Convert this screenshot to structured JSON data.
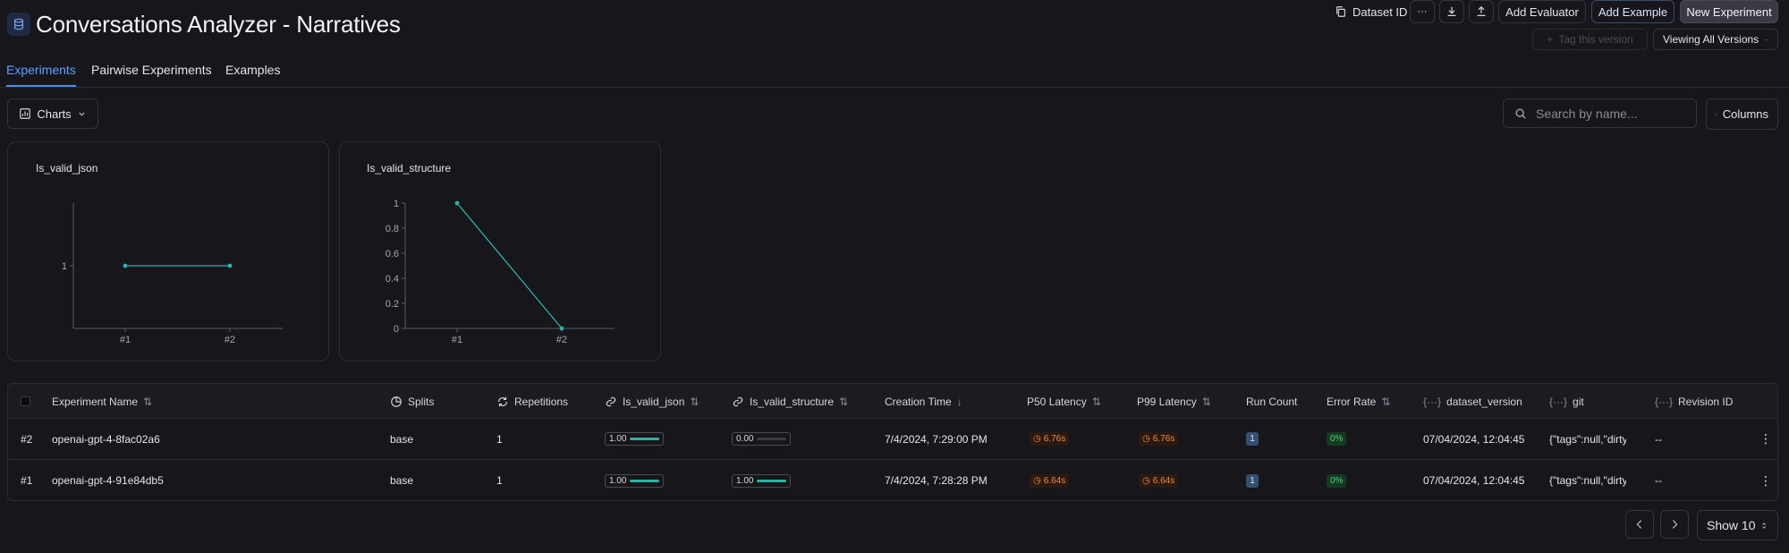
{
  "header": {
    "title": "Conversations Analyzer - Narratives",
    "dataset_id_label": "Dataset ID",
    "more_label": "···",
    "add_evaluator_label": "Add Evaluator",
    "add_example_label": "Add Example",
    "new_experiment_label": "New Experiment",
    "tag_version_label": "Tag this version",
    "version_select": "Viewing All Versions"
  },
  "tabs": [
    {
      "label": "Experiments",
      "active": true
    },
    {
      "label": "Pairwise Experiments",
      "active": false
    },
    {
      "label": "Examples",
      "active": false
    }
  ],
  "toolbar": {
    "charts_label": "Charts",
    "search_placeholder": "Search by name...",
    "columns_label": "Columns"
  },
  "chart_data": [
    {
      "type": "line",
      "title": "Is_valid_json",
      "x": [
        "#1",
        "#2"
      ],
      "series": [
        {
          "values": [
            1,
            1
          ]
        }
      ],
      "yticks": [
        "1"
      ],
      "color": "#2bb3a8"
    },
    {
      "type": "line",
      "title": "Is_valid_structure",
      "x": [
        "#1",
        "#2"
      ],
      "series": [
        {
          "values": [
            1,
            0
          ]
        }
      ],
      "yticks": [
        "0",
        "0.2",
        "0.4",
        "0.6",
        "0.8",
        "1"
      ],
      "ylim": [
        0,
        1
      ],
      "color": "#2bb3a8"
    }
  ],
  "table": {
    "columns": {
      "name": "Experiment Name",
      "splits": "Splits",
      "repetitions": "Repetitions",
      "is_valid_json": "Is_valid_json",
      "is_valid_structure": "Is_valid_structure",
      "creation_time": "Creation Time",
      "p50": "P50 Latency",
      "p99": "P99 Latency",
      "run_count": "Run Count",
      "error_rate": "Error Rate",
      "dataset_version": "dataset_version",
      "git": "git",
      "revision_id": "Revision ID"
    },
    "rows": [
      {
        "index": "#2",
        "name": "openai-gpt-4-8fac02a6",
        "splits": "base",
        "repetitions": "1",
        "is_valid_json": "1.00",
        "is_valid_json_fill": 1.0,
        "is_valid_structure": "0.00",
        "is_valid_structure_fill": 0.0,
        "creation_time": "7/4/2024, 7:29:00 PM",
        "p50": "6.76s",
        "p99": "6.76s",
        "run_count": "1",
        "error_rate": "0%",
        "dataset_version": "07/04/2024, 12:04:45",
        "git": "{\"tags\":null,\"dirty\"",
        "revision_id": "--"
      },
      {
        "index": "#1",
        "name": "openai-gpt-4-91e84db5",
        "splits": "base",
        "repetitions": "1",
        "is_valid_json": "1.00",
        "is_valid_json_fill": 1.0,
        "is_valid_structure": "1.00",
        "is_valid_structure_fill": 1.0,
        "creation_time": "7/4/2024, 7:28:28 PM",
        "p50": "6.64s",
        "p99": "6.64s",
        "run_count": "1",
        "error_rate": "0%",
        "dataset_version": "07/04/2024, 12:04:45",
        "git": "{\"tags\":null,\"dirty\"",
        "revision_id": "--"
      }
    ]
  },
  "pagination": {
    "show_label": "Show 10"
  }
}
